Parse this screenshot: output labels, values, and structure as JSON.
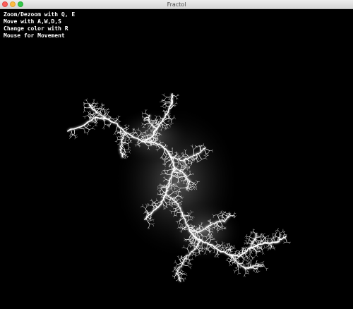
{
  "window": {
    "title": "Fractol"
  },
  "instructions": [
    "Zoom/Dezoom with Q, E",
    "Move with A,W,D,S",
    "Change color with R",
    "Mouse for Movement"
  ],
  "fractal": {
    "color": "#ffffff",
    "glow": "#bdbdbd",
    "background": "#000000"
  }
}
